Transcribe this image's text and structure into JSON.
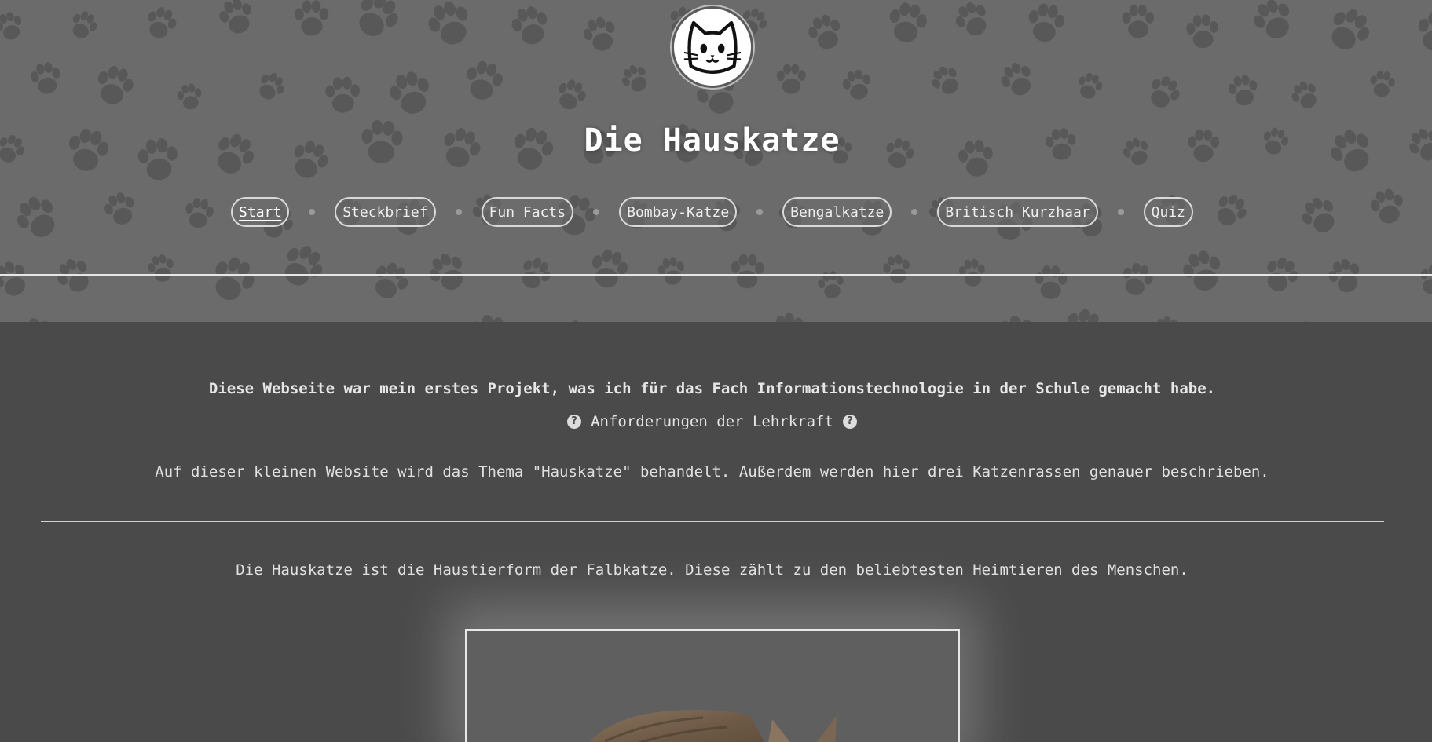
{
  "site": {
    "title": "Die Hauskatze",
    "logo_icon": "cat-face-icon"
  },
  "nav": {
    "items": [
      {
        "label": "Start",
        "active": true
      },
      {
        "label": "Steckbrief",
        "active": false
      },
      {
        "label": "Fun Facts",
        "active": false
      },
      {
        "label": "Bombay-Katze",
        "active": false
      },
      {
        "label": "Bengalkatze",
        "active": false
      },
      {
        "label": "Britisch Kurzhaar",
        "active": false
      },
      {
        "label": "Quiz",
        "active": false
      }
    ]
  },
  "main": {
    "intro": "Diese Webseite war mein erstes Projekt, was ich für das Fach Informationstechnologie in der Schule gemacht habe.",
    "requirements_link": "Anforderungen der Lehrkraft",
    "requirements_icon": "question-circle-icon",
    "description": "Auf dieser kleinen Website wird das Thema \"Hauskatze\" behandelt. Außerdem werden hier drei Katzenrassen genauer beschrieben.",
    "fact": "Die Hauskatze ist die Haustierform der Falbkatze. Diese zählt zu den beliebtesten Heimtieren des Menschen.",
    "photo_icon": "cat-photo"
  },
  "colors": {
    "background": "#4a4a4a",
    "header": "#6b6b6b",
    "paw": "#555555",
    "text": "#e6e6e6"
  }
}
